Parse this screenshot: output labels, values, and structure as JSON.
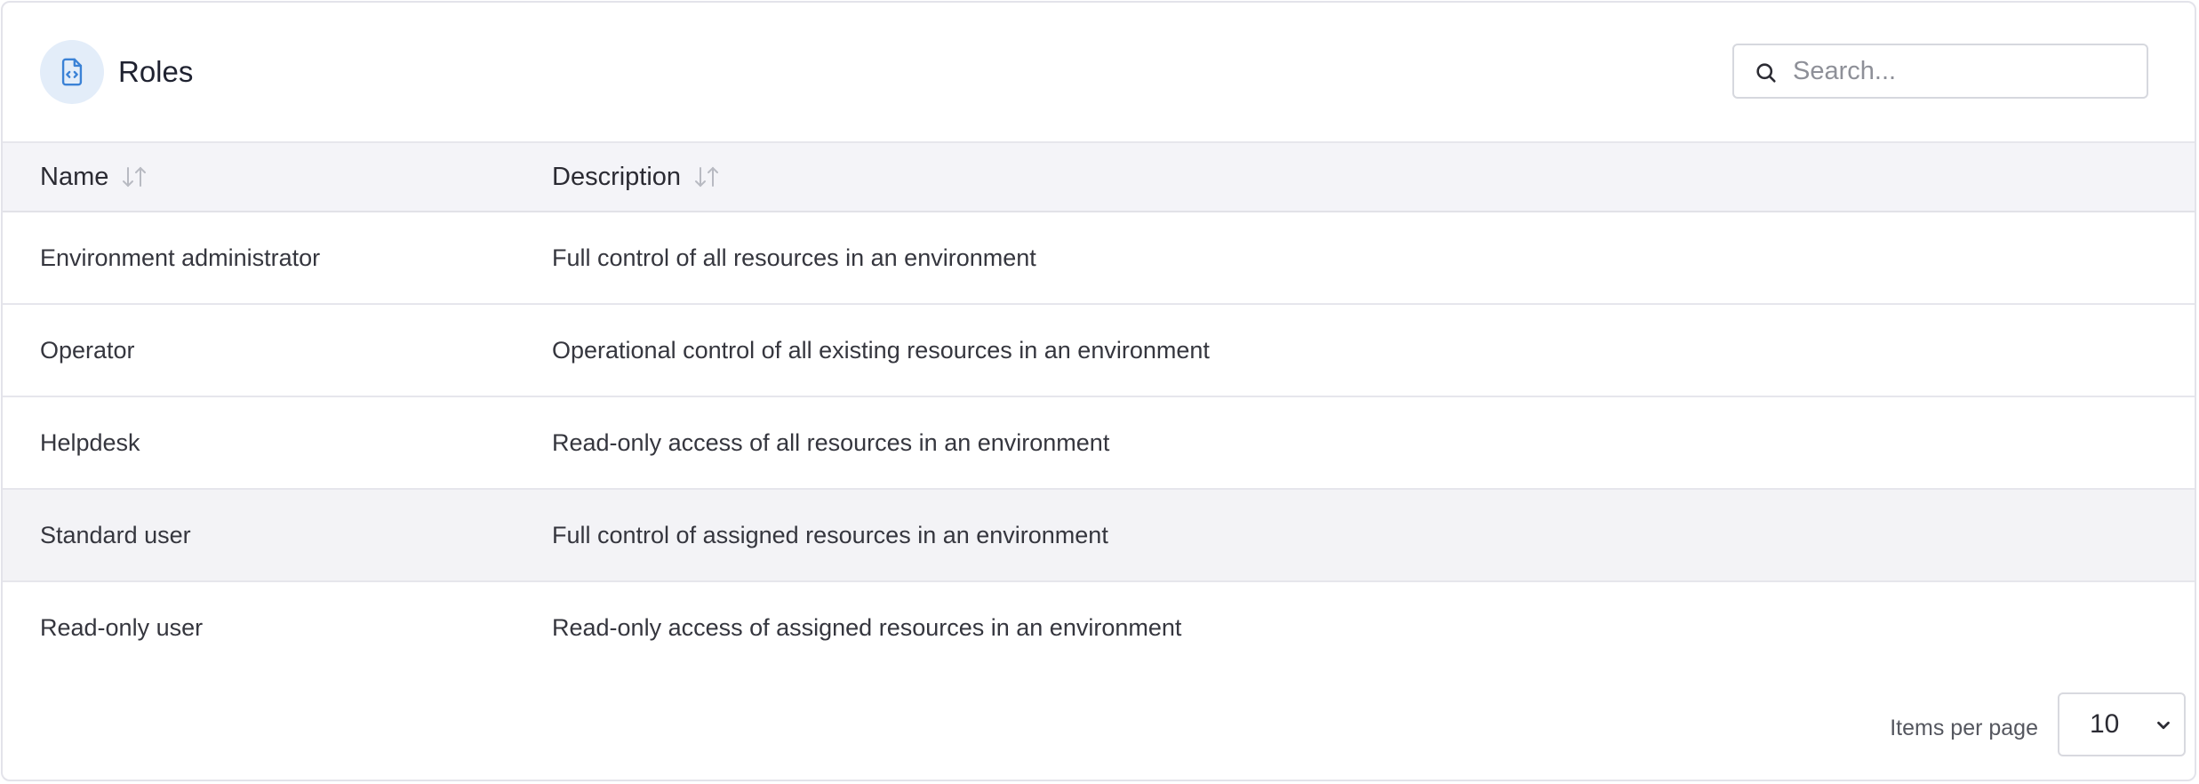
{
  "header": {
    "title": "Roles",
    "icon": "document-code-icon",
    "accent_color": "#3b82d6",
    "icon_bg": "#e3edf9"
  },
  "search": {
    "placeholder": "Search...",
    "value": "",
    "icon": "search-icon"
  },
  "table": {
    "columns": [
      {
        "label": "Name",
        "sort_icon": "sort-icon"
      },
      {
        "label": "Description",
        "sort_icon": "sort-icon"
      }
    ],
    "rows": [
      {
        "name": "Environment administrator",
        "description": "Full control of all resources in an environment"
      },
      {
        "name": "Operator",
        "description": "Operational control of all existing resources in an environment"
      },
      {
        "name": "Helpdesk",
        "description": "Read-only access of all resources in an environment"
      },
      {
        "name": "Standard user",
        "description": "Full control of assigned resources in an environment"
      },
      {
        "name": "Read-only user",
        "description": "Read-only access of assigned resources in an environment"
      }
    ],
    "hovered_row_index": 3
  },
  "pagination": {
    "items_per_page_label": "Items per page",
    "items_per_page_value": "10",
    "items_per_page_options": [
      "10"
    ]
  }
}
